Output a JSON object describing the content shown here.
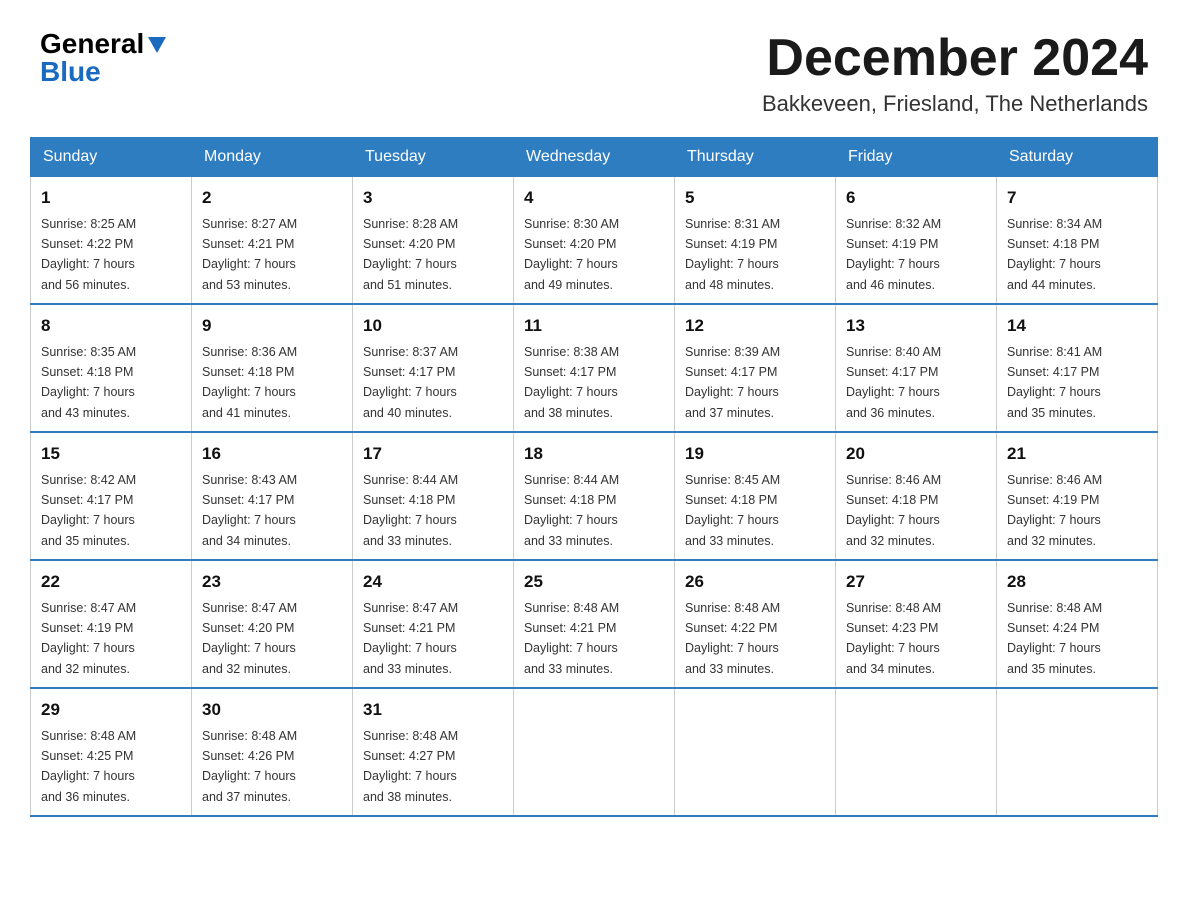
{
  "header": {
    "logo": {
      "general": "General",
      "blue": "Blue",
      "alt": "GeneralBlue logo"
    },
    "month_title": "December 2024",
    "location": "Bakkeveen, Friesland, The Netherlands"
  },
  "weekdays": [
    "Sunday",
    "Monday",
    "Tuesday",
    "Wednesday",
    "Thursday",
    "Friday",
    "Saturday"
  ],
  "weeks": [
    [
      {
        "day": "1",
        "sunrise": "Sunrise: 8:25 AM",
        "sunset": "Sunset: 4:22 PM",
        "daylight": "Daylight: 7 hours",
        "minutes": "and 56 minutes."
      },
      {
        "day": "2",
        "sunrise": "Sunrise: 8:27 AM",
        "sunset": "Sunset: 4:21 PM",
        "daylight": "Daylight: 7 hours",
        "minutes": "and 53 minutes."
      },
      {
        "day": "3",
        "sunrise": "Sunrise: 8:28 AM",
        "sunset": "Sunset: 4:20 PM",
        "daylight": "Daylight: 7 hours",
        "minutes": "and 51 minutes."
      },
      {
        "day": "4",
        "sunrise": "Sunrise: 8:30 AM",
        "sunset": "Sunset: 4:20 PM",
        "daylight": "Daylight: 7 hours",
        "minutes": "and 49 minutes."
      },
      {
        "day": "5",
        "sunrise": "Sunrise: 8:31 AM",
        "sunset": "Sunset: 4:19 PM",
        "daylight": "Daylight: 7 hours",
        "minutes": "and 48 minutes."
      },
      {
        "day": "6",
        "sunrise": "Sunrise: 8:32 AM",
        "sunset": "Sunset: 4:19 PM",
        "daylight": "Daylight: 7 hours",
        "minutes": "and 46 minutes."
      },
      {
        "day": "7",
        "sunrise": "Sunrise: 8:34 AM",
        "sunset": "Sunset: 4:18 PM",
        "daylight": "Daylight: 7 hours",
        "minutes": "and 44 minutes."
      }
    ],
    [
      {
        "day": "8",
        "sunrise": "Sunrise: 8:35 AM",
        "sunset": "Sunset: 4:18 PM",
        "daylight": "Daylight: 7 hours",
        "minutes": "and 43 minutes."
      },
      {
        "day": "9",
        "sunrise": "Sunrise: 8:36 AM",
        "sunset": "Sunset: 4:18 PM",
        "daylight": "Daylight: 7 hours",
        "minutes": "and 41 minutes."
      },
      {
        "day": "10",
        "sunrise": "Sunrise: 8:37 AM",
        "sunset": "Sunset: 4:17 PM",
        "daylight": "Daylight: 7 hours",
        "minutes": "and 40 minutes."
      },
      {
        "day": "11",
        "sunrise": "Sunrise: 8:38 AM",
        "sunset": "Sunset: 4:17 PM",
        "daylight": "Daylight: 7 hours",
        "minutes": "and 38 minutes."
      },
      {
        "day": "12",
        "sunrise": "Sunrise: 8:39 AM",
        "sunset": "Sunset: 4:17 PM",
        "daylight": "Daylight: 7 hours",
        "minutes": "and 37 minutes."
      },
      {
        "day": "13",
        "sunrise": "Sunrise: 8:40 AM",
        "sunset": "Sunset: 4:17 PM",
        "daylight": "Daylight: 7 hours",
        "minutes": "and 36 minutes."
      },
      {
        "day": "14",
        "sunrise": "Sunrise: 8:41 AM",
        "sunset": "Sunset: 4:17 PM",
        "daylight": "Daylight: 7 hours",
        "minutes": "and 35 minutes."
      }
    ],
    [
      {
        "day": "15",
        "sunrise": "Sunrise: 8:42 AM",
        "sunset": "Sunset: 4:17 PM",
        "daylight": "Daylight: 7 hours",
        "minutes": "and 35 minutes."
      },
      {
        "day": "16",
        "sunrise": "Sunrise: 8:43 AM",
        "sunset": "Sunset: 4:17 PM",
        "daylight": "Daylight: 7 hours",
        "minutes": "and 34 minutes."
      },
      {
        "day": "17",
        "sunrise": "Sunrise: 8:44 AM",
        "sunset": "Sunset: 4:18 PM",
        "daylight": "Daylight: 7 hours",
        "minutes": "and 33 minutes."
      },
      {
        "day": "18",
        "sunrise": "Sunrise: 8:44 AM",
        "sunset": "Sunset: 4:18 PM",
        "daylight": "Daylight: 7 hours",
        "minutes": "and 33 minutes."
      },
      {
        "day": "19",
        "sunrise": "Sunrise: 8:45 AM",
        "sunset": "Sunset: 4:18 PM",
        "daylight": "Daylight: 7 hours",
        "minutes": "and 33 minutes."
      },
      {
        "day": "20",
        "sunrise": "Sunrise: 8:46 AM",
        "sunset": "Sunset: 4:18 PM",
        "daylight": "Daylight: 7 hours",
        "minutes": "and 32 minutes."
      },
      {
        "day": "21",
        "sunrise": "Sunrise: 8:46 AM",
        "sunset": "Sunset: 4:19 PM",
        "daylight": "Daylight: 7 hours",
        "minutes": "and 32 minutes."
      }
    ],
    [
      {
        "day": "22",
        "sunrise": "Sunrise: 8:47 AM",
        "sunset": "Sunset: 4:19 PM",
        "daylight": "Daylight: 7 hours",
        "minutes": "and 32 minutes."
      },
      {
        "day": "23",
        "sunrise": "Sunrise: 8:47 AM",
        "sunset": "Sunset: 4:20 PM",
        "daylight": "Daylight: 7 hours",
        "minutes": "and 32 minutes."
      },
      {
        "day": "24",
        "sunrise": "Sunrise: 8:47 AM",
        "sunset": "Sunset: 4:21 PM",
        "daylight": "Daylight: 7 hours",
        "minutes": "and 33 minutes."
      },
      {
        "day": "25",
        "sunrise": "Sunrise: 8:48 AM",
        "sunset": "Sunset: 4:21 PM",
        "daylight": "Daylight: 7 hours",
        "minutes": "and 33 minutes."
      },
      {
        "day": "26",
        "sunrise": "Sunrise: 8:48 AM",
        "sunset": "Sunset: 4:22 PM",
        "daylight": "Daylight: 7 hours",
        "minutes": "and 33 minutes."
      },
      {
        "day": "27",
        "sunrise": "Sunrise: 8:48 AM",
        "sunset": "Sunset: 4:23 PM",
        "daylight": "Daylight: 7 hours",
        "minutes": "and 34 minutes."
      },
      {
        "day": "28",
        "sunrise": "Sunrise: 8:48 AM",
        "sunset": "Sunset: 4:24 PM",
        "daylight": "Daylight: 7 hours",
        "minutes": "and 35 minutes."
      }
    ],
    [
      {
        "day": "29",
        "sunrise": "Sunrise: 8:48 AM",
        "sunset": "Sunset: 4:25 PM",
        "daylight": "Daylight: 7 hours",
        "minutes": "and 36 minutes."
      },
      {
        "day": "30",
        "sunrise": "Sunrise: 8:48 AM",
        "sunset": "Sunset: 4:26 PM",
        "daylight": "Daylight: 7 hours",
        "minutes": "and 37 minutes."
      },
      {
        "day": "31",
        "sunrise": "Sunrise: 8:48 AM",
        "sunset": "Sunset: 4:27 PM",
        "daylight": "Daylight: 7 hours",
        "minutes": "and 38 minutes."
      },
      null,
      null,
      null,
      null
    ]
  ],
  "colors": {
    "header_bg": "#2e7dc0",
    "border_accent": "#2e7dc0",
    "logo_blue": "#1a6bbf"
  }
}
